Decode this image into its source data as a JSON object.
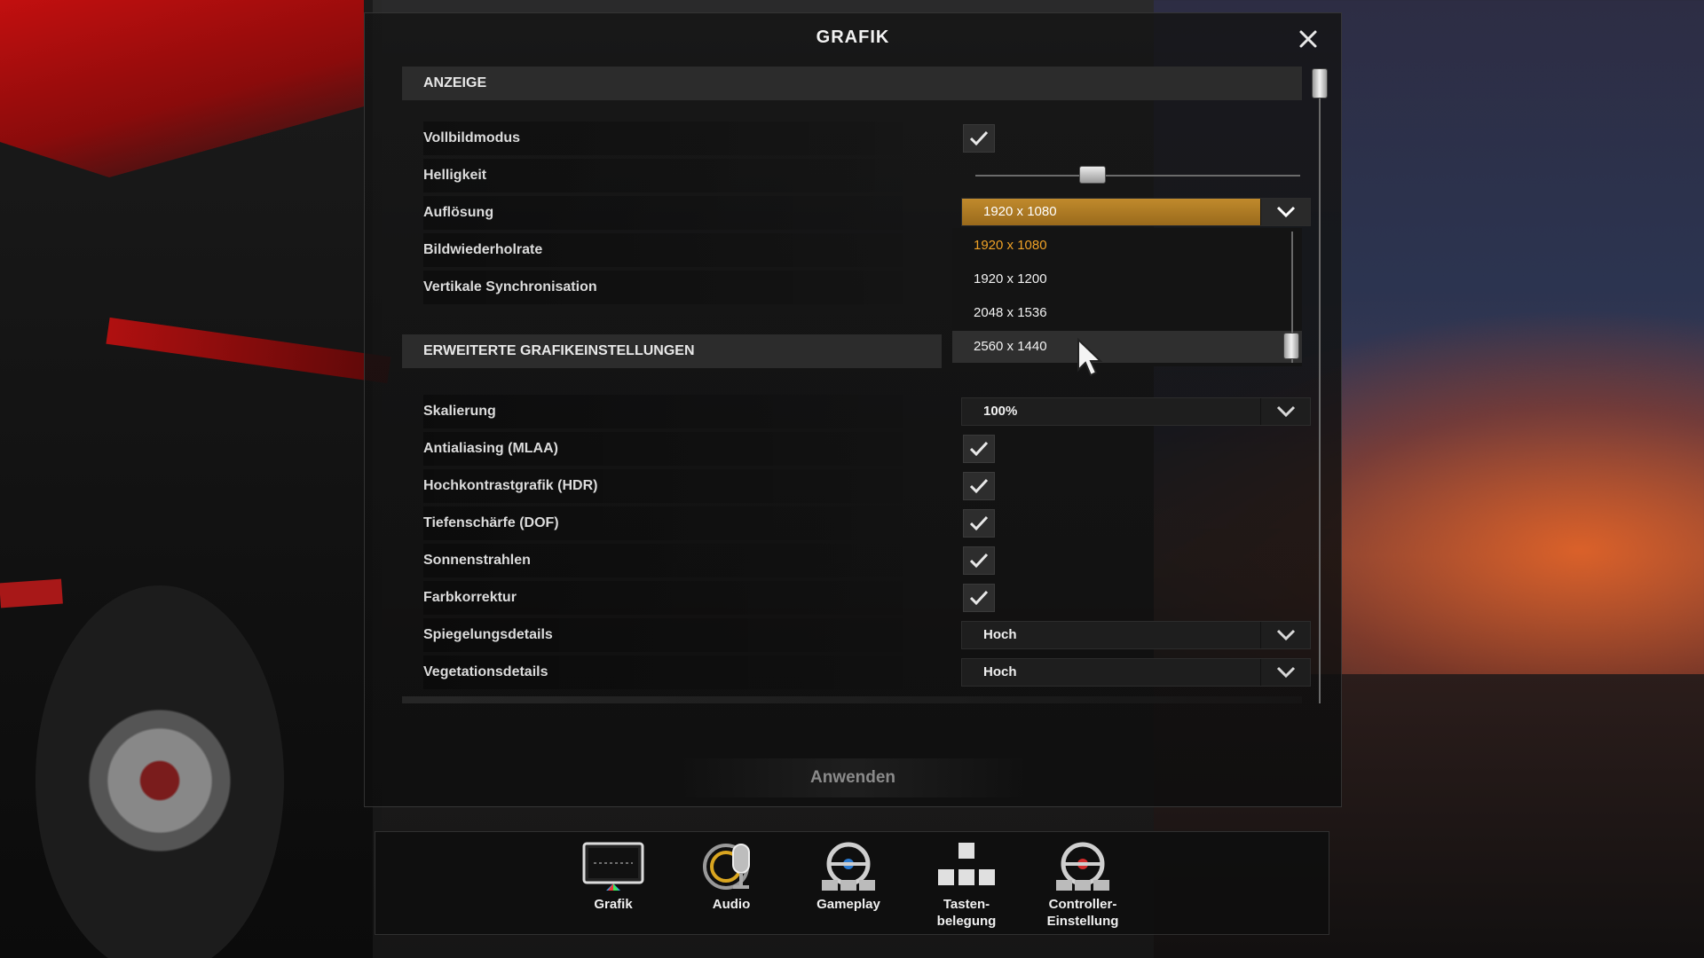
{
  "dialog": {
    "title": "GRAFIK",
    "close_icon": "close-icon"
  },
  "sections": {
    "display_header": "ANZEIGE",
    "advanced_header": "ERWEITERTE GRAFIKEINSTELLUNGEN"
  },
  "display": {
    "fullscreen": {
      "label": "Vollbildmodus",
      "checked": true
    },
    "brightness": {
      "label": "Helligkeit",
      "value_fraction": 0.36
    },
    "resolution": {
      "label": "Auflösung",
      "value": "1920 x 1080",
      "options": [
        "1920 x 1080",
        "1920 x 1200",
        "2048 x 1536",
        "2560 x 1440"
      ],
      "selected_index": 0,
      "hovered_index": 3
    },
    "refresh_rate": {
      "label": "Bildwiederholrate"
    },
    "vsync": {
      "label": "Vertikale Synchronisation"
    }
  },
  "advanced": {
    "scaling": {
      "label": "Skalierung",
      "value": "100%"
    },
    "antialiasing": {
      "label": "Antialiasing (MLAA)",
      "checked": true
    },
    "hdr": {
      "label": "Hochkontrastgrafik (HDR)",
      "checked": true
    },
    "dof": {
      "label": "Tiefenschärfe (DOF)",
      "checked": true
    },
    "sunrays": {
      "label": "Sonnenstrahlen",
      "checked": true
    },
    "color_correction": {
      "label": "Farbkorrektur",
      "checked": true
    },
    "reflection": {
      "label": "Spiegelungsdetails",
      "value": "Hoch"
    },
    "vegetation": {
      "label": "Vegetationsdetails",
      "value": "Hoch"
    }
  },
  "apply_label": "Anwenden",
  "nav": {
    "items": [
      {
        "label": "Grafik",
        "label2": "",
        "icon": "monitor-icon"
      },
      {
        "label": "Audio",
        "label2": "",
        "icon": "microphone-icon"
      },
      {
        "label": "Gameplay",
        "label2": "",
        "icon": "steering-wheel-icon"
      },
      {
        "label": "Tasten-",
        "label2": "belegung",
        "icon": "keys-icon"
      },
      {
        "label": "Controller-",
        "label2": "Einstellung",
        "icon": "controller-wheel-icon"
      }
    ]
  },
  "colors": {
    "accent": "#f0a226",
    "active_dropdown": "#c08a2c"
  }
}
